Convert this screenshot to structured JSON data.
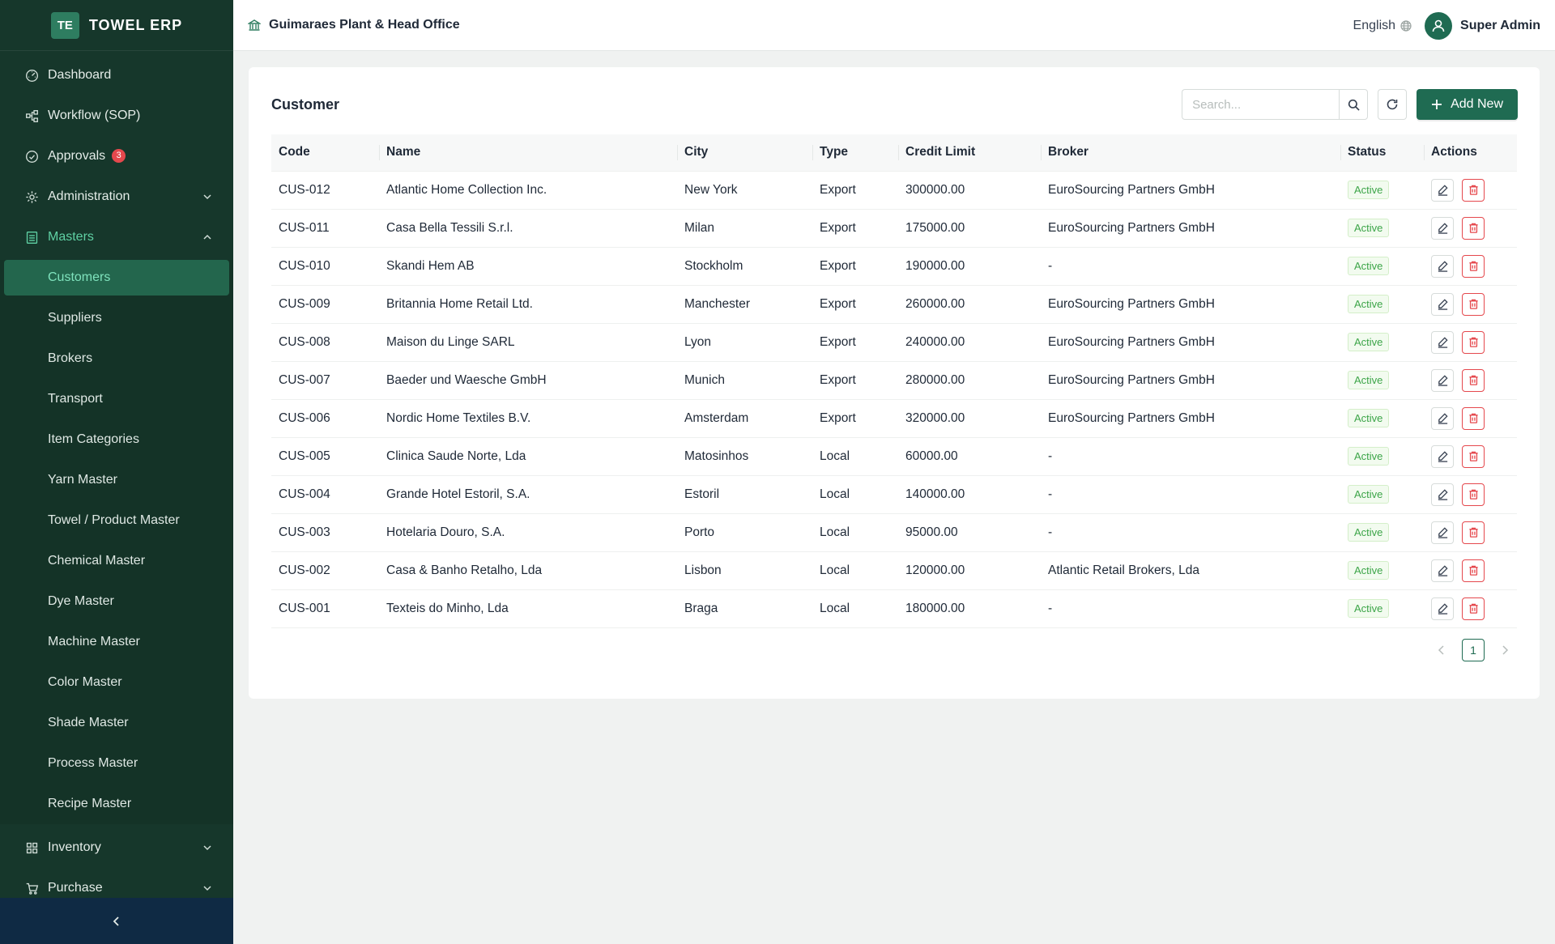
{
  "app": {
    "logo_text": "TE",
    "name": "TOWEL ERP"
  },
  "header": {
    "org_name": "Guimaraes Plant & Head Office",
    "language": "English",
    "user_name": "Super Admin"
  },
  "sidebar": {
    "top_items": [
      {
        "label": "Dashboard",
        "icon": "dashboard-icon"
      },
      {
        "label": "Workflow (SOP)",
        "icon": "workflow-icon"
      },
      {
        "label": "Approvals",
        "icon": "check-circle-icon",
        "badge": "3"
      },
      {
        "label": "Administration",
        "icon": "gear-icon"
      },
      {
        "label": "Masters",
        "icon": "list-icon"
      }
    ],
    "masters_items": [
      {
        "label": "Customers",
        "active": true
      },
      {
        "label": "Suppliers"
      },
      {
        "label": "Brokers"
      },
      {
        "label": "Transport"
      },
      {
        "label": "Item Categories"
      },
      {
        "label": "Yarn Master"
      },
      {
        "label": "Towel / Product Master"
      },
      {
        "label": "Chemical Master"
      },
      {
        "label": "Dye Master"
      },
      {
        "label": "Machine Master"
      },
      {
        "label": "Color Master"
      },
      {
        "label": "Shade Master"
      },
      {
        "label": "Process Master"
      },
      {
        "label": "Recipe Master"
      }
    ],
    "bottom_items": [
      {
        "label": "Inventory",
        "icon": "grid-icon"
      },
      {
        "label": "Purchase",
        "icon": "cart-icon"
      }
    ]
  },
  "page": {
    "title": "Customer",
    "search_placeholder": "Search...",
    "add_label": "Add New"
  },
  "table": {
    "columns": [
      "Code",
      "Name",
      "City",
      "Type",
      "Credit Limit",
      "Broker",
      "Status",
      "Actions"
    ],
    "rows": [
      {
        "code": "CUS-012",
        "name": "Atlantic Home Collection Inc.",
        "city": "New York",
        "type": "Export",
        "credit": "300000.00",
        "broker": "EuroSourcing Partners GmbH",
        "status": "Active"
      },
      {
        "code": "CUS-011",
        "name": "Casa Bella Tessili S.r.l.",
        "city": "Milan",
        "type": "Export",
        "credit": "175000.00",
        "broker": "EuroSourcing Partners GmbH",
        "status": "Active"
      },
      {
        "code": "CUS-010",
        "name": "Skandi Hem AB",
        "city": "Stockholm",
        "type": "Export",
        "credit": "190000.00",
        "broker": "-",
        "status": "Active"
      },
      {
        "code": "CUS-009",
        "name": "Britannia Home Retail Ltd.",
        "city": "Manchester",
        "type": "Export",
        "credit": "260000.00",
        "broker": "EuroSourcing Partners GmbH",
        "status": "Active"
      },
      {
        "code": "CUS-008",
        "name": "Maison du Linge SARL",
        "city": "Lyon",
        "type": "Export",
        "credit": "240000.00",
        "broker": "EuroSourcing Partners GmbH",
        "status": "Active"
      },
      {
        "code": "CUS-007",
        "name": "Baeder und Waesche GmbH",
        "city": "Munich",
        "type": "Export",
        "credit": "280000.00",
        "broker": "EuroSourcing Partners GmbH",
        "status": "Active"
      },
      {
        "code": "CUS-006",
        "name": "Nordic Home Textiles B.V.",
        "city": "Amsterdam",
        "type": "Export",
        "credit": "320000.00",
        "broker": "EuroSourcing Partners GmbH",
        "status": "Active"
      },
      {
        "code": "CUS-005",
        "name": "Clinica Saude Norte, Lda",
        "city": "Matosinhos",
        "type": "Local",
        "credit": "60000.00",
        "broker": "-",
        "status": "Active"
      },
      {
        "code": "CUS-004",
        "name": "Grande Hotel Estoril, S.A.",
        "city": "Estoril",
        "type": "Local",
        "credit": "140000.00",
        "broker": "-",
        "status": "Active"
      },
      {
        "code": "CUS-003",
        "name": "Hotelaria Douro, S.A.",
        "city": "Porto",
        "type": "Local",
        "credit": "95000.00",
        "broker": "-",
        "status": "Active"
      },
      {
        "code": "CUS-002",
        "name": "Casa & Banho Retalho, Lda",
        "city": "Lisbon",
        "type": "Local",
        "credit": "120000.00",
        "broker": "Atlantic Retail Brokers, Lda",
        "status": "Active"
      },
      {
        "code": "CUS-001",
        "name": "Texteis do Minho, Lda",
        "city": "Braga",
        "type": "Local",
        "credit": "180000.00",
        "broker": "-",
        "status": "Active"
      }
    ]
  },
  "pagination": {
    "current_page": "1"
  },
  "colors": {
    "sidebar_bg": "#16372b",
    "accent": "#1f6b52",
    "active_text": "#7fe3bd",
    "danger": "#e5484d",
    "success": "#3ca548"
  }
}
